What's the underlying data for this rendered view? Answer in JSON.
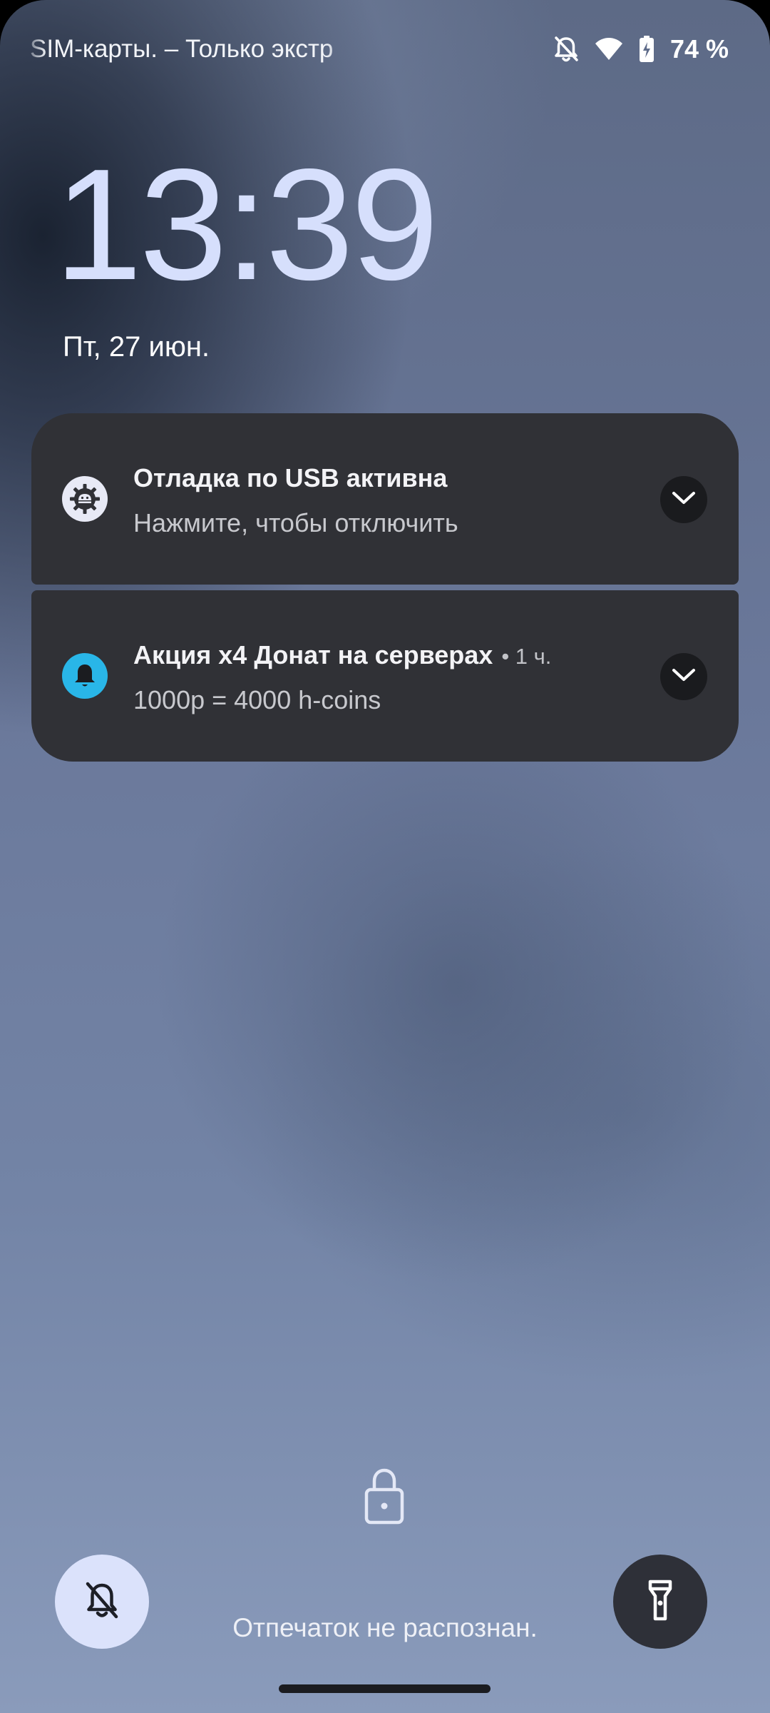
{
  "status_bar": {
    "carrier_text": "SIM-карты. – Только экстр",
    "battery_percent": "74 %",
    "icons": [
      "notifications-off-icon",
      "wifi-icon",
      "battery-charging-icon"
    ]
  },
  "lockscreen": {
    "time": "13:39",
    "date": "Пт, 27 июн."
  },
  "notifications": [
    {
      "icon": "android-debug-icon",
      "title": "Отладка по USB активна",
      "meta": "",
      "body": "Нажмите, чтобы отключить",
      "icon_bg": "#e8eaf6"
    },
    {
      "icon": "bell-icon",
      "title": "Акция х4 Донат на серверах",
      "meta": "• 1 ч.",
      "body": "1000р = 4000 h-coins",
      "icon_bg": "#29b6e8"
    }
  ],
  "bottom": {
    "left_shortcut_icon": "notifications-off-icon",
    "right_shortcut_icon": "flashlight-icon",
    "fingerprint_message": "Отпечаток не распознан."
  },
  "colors": {
    "clock": "#d6dffc",
    "notification_bg": "#303136",
    "accent_blue": "#29b6e8",
    "shortcut_light": "#dbe2fb",
    "shortcut_dark": "#2e3038"
  }
}
